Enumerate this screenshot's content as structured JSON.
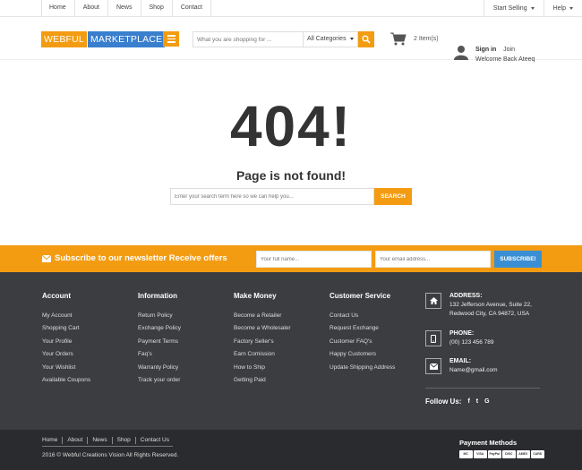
{
  "topbar": {
    "nav": [
      "Home",
      "About",
      "News",
      "Shop",
      "Contact"
    ],
    "start_selling": "Start Selling",
    "help": "Help"
  },
  "header": {
    "logo_part1": "WEBFUL",
    "logo_part2": "MARKETPLACE",
    "search_placeholder": "What you are shopping for ...",
    "category_selected": "All Categories",
    "cart_count": "2 Item(s)",
    "sign_in": "Sign in",
    "join": "Join",
    "welcome": "Welcome Back Ateeq"
  },
  "error": {
    "code": "404!",
    "message": "Page is not found!",
    "search_placeholder": "Enter your search term here so we can help you...",
    "search_button": "SEARCH"
  },
  "newsletter": {
    "title": "Subscribe to our newsletter Receive offers",
    "name_placeholder": "Your full name...",
    "email_placeholder": "Your email address...",
    "button": "SUBSCRIBE!"
  },
  "footer": {
    "columns": [
      {
        "title": "Account",
        "links": [
          "My Account",
          "Shopping Cart",
          "Your Profile",
          "Your Orders",
          "Your Wishlist",
          "Available Coupons"
        ]
      },
      {
        "title": "Information",
        "links": [
          "Return Policy",
          "Exchange Policy",
          "Payment Terms",
          "Faq's",
          "Warranty Policy",
          "Track your order"
        ]
      },
      {
        "title": "Make Money",
        "links": [
          "Become a Retailer",
          "Become a Wholesaler",
          "Factory Seller's",
          "Earn Comission",
          "How to Ship",
          "Getting Paid"
        ]
      },
      {
        "title": "Customer Service",
        "links": [
          "Contact Us",
          "Request Exchange",
          "Customer FAQ's",
          "Happy Customers",
          "Update Shipping Address"
        ]
      }
    ],
    "address_label": "ADDRESS:",
    "address_line1": "132 Jefferson Avenue, Suite 22,",
    "address_line2": "Redwood City, CA 94872, USA",
    "phone_label": "PHONE:",
    "phone": "(00) 123 456 789",
    "email_label": "EMAIL:",
    "email": "Name@gmail.com",
    "follow_us": "Follow Us:",
    "social": [
      "f",
      "t",
      "G"
    ]
  },
  "bottom": {
    "nav": [
      "Home",
      "About",
      "News",
      "Shop",
      "Contact Us"
    ],
    "copyright": "2016 © Webful Creations Vision All Rights Reserved.",
    "payment_title": "Payment Methods",
    "payment_methods": [
      "MC",
      "VISA",
      "PayPal",
      "DISC",
      "AMEX",
      "CARD"
    ]
  },
  "colors": {
    "accent": "#f39c12",
    "logo_blue": "#3a7fce",
    "subscribe_blue": "#3a8fd4",
    "footer_bg": "#3c3d41",
    "bottom_bg": "#2a2b2e"
  }
}
